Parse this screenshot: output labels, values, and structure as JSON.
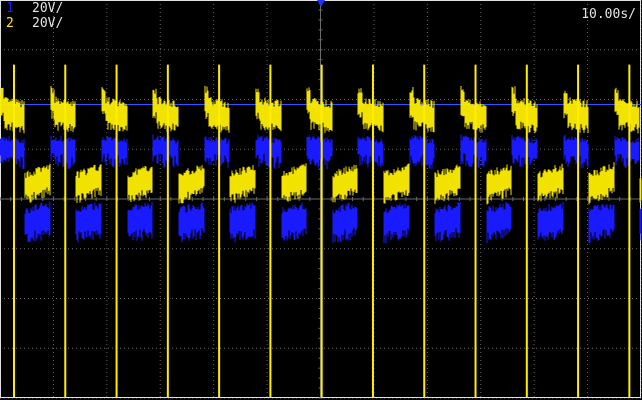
{
  "colors": {
    "background": "#000000",
    "grid": "#e0e0e0",
    "grid_dim": "#6a6a6a",
    "ch1": "#1a1aff",
    "ch2": "#ffee00",
    "ch1_ref": "#3355ff"
  },
  "channels": [
    {
      "number": "1",
      "scale": "20V/",
      "color": "#1a1aff"
    },
    {
      "number": "2",
      "scale": "20V/",
      "color": "#ffee00"
    }
  ],
  "timebase": "10.00s/",
  "chart_data": {
    "type": "line",
    "grid": true,
    "divisions": {
      "x": 12,
      "y": 8
    },
    "series": [
      {
        "name": "1",
        "description": "square-like periodic signal, blue, roughly level 2.9 to 4.6 divisions from top with noise bursts",
        "periods": 12.5,
        "high_level_div": 2.9,
        "low_level_div": 4.5
      },
      {
        "name": "2",
        "description": "yellow periodic signal with tall spikes to bottom of screen each period",
        "periods": 12.5,
        "high_level_div": 2.2,
        "low_level_div": 3.8,
        "spike_level_div": 8.0
      }
    ]
  }
}
